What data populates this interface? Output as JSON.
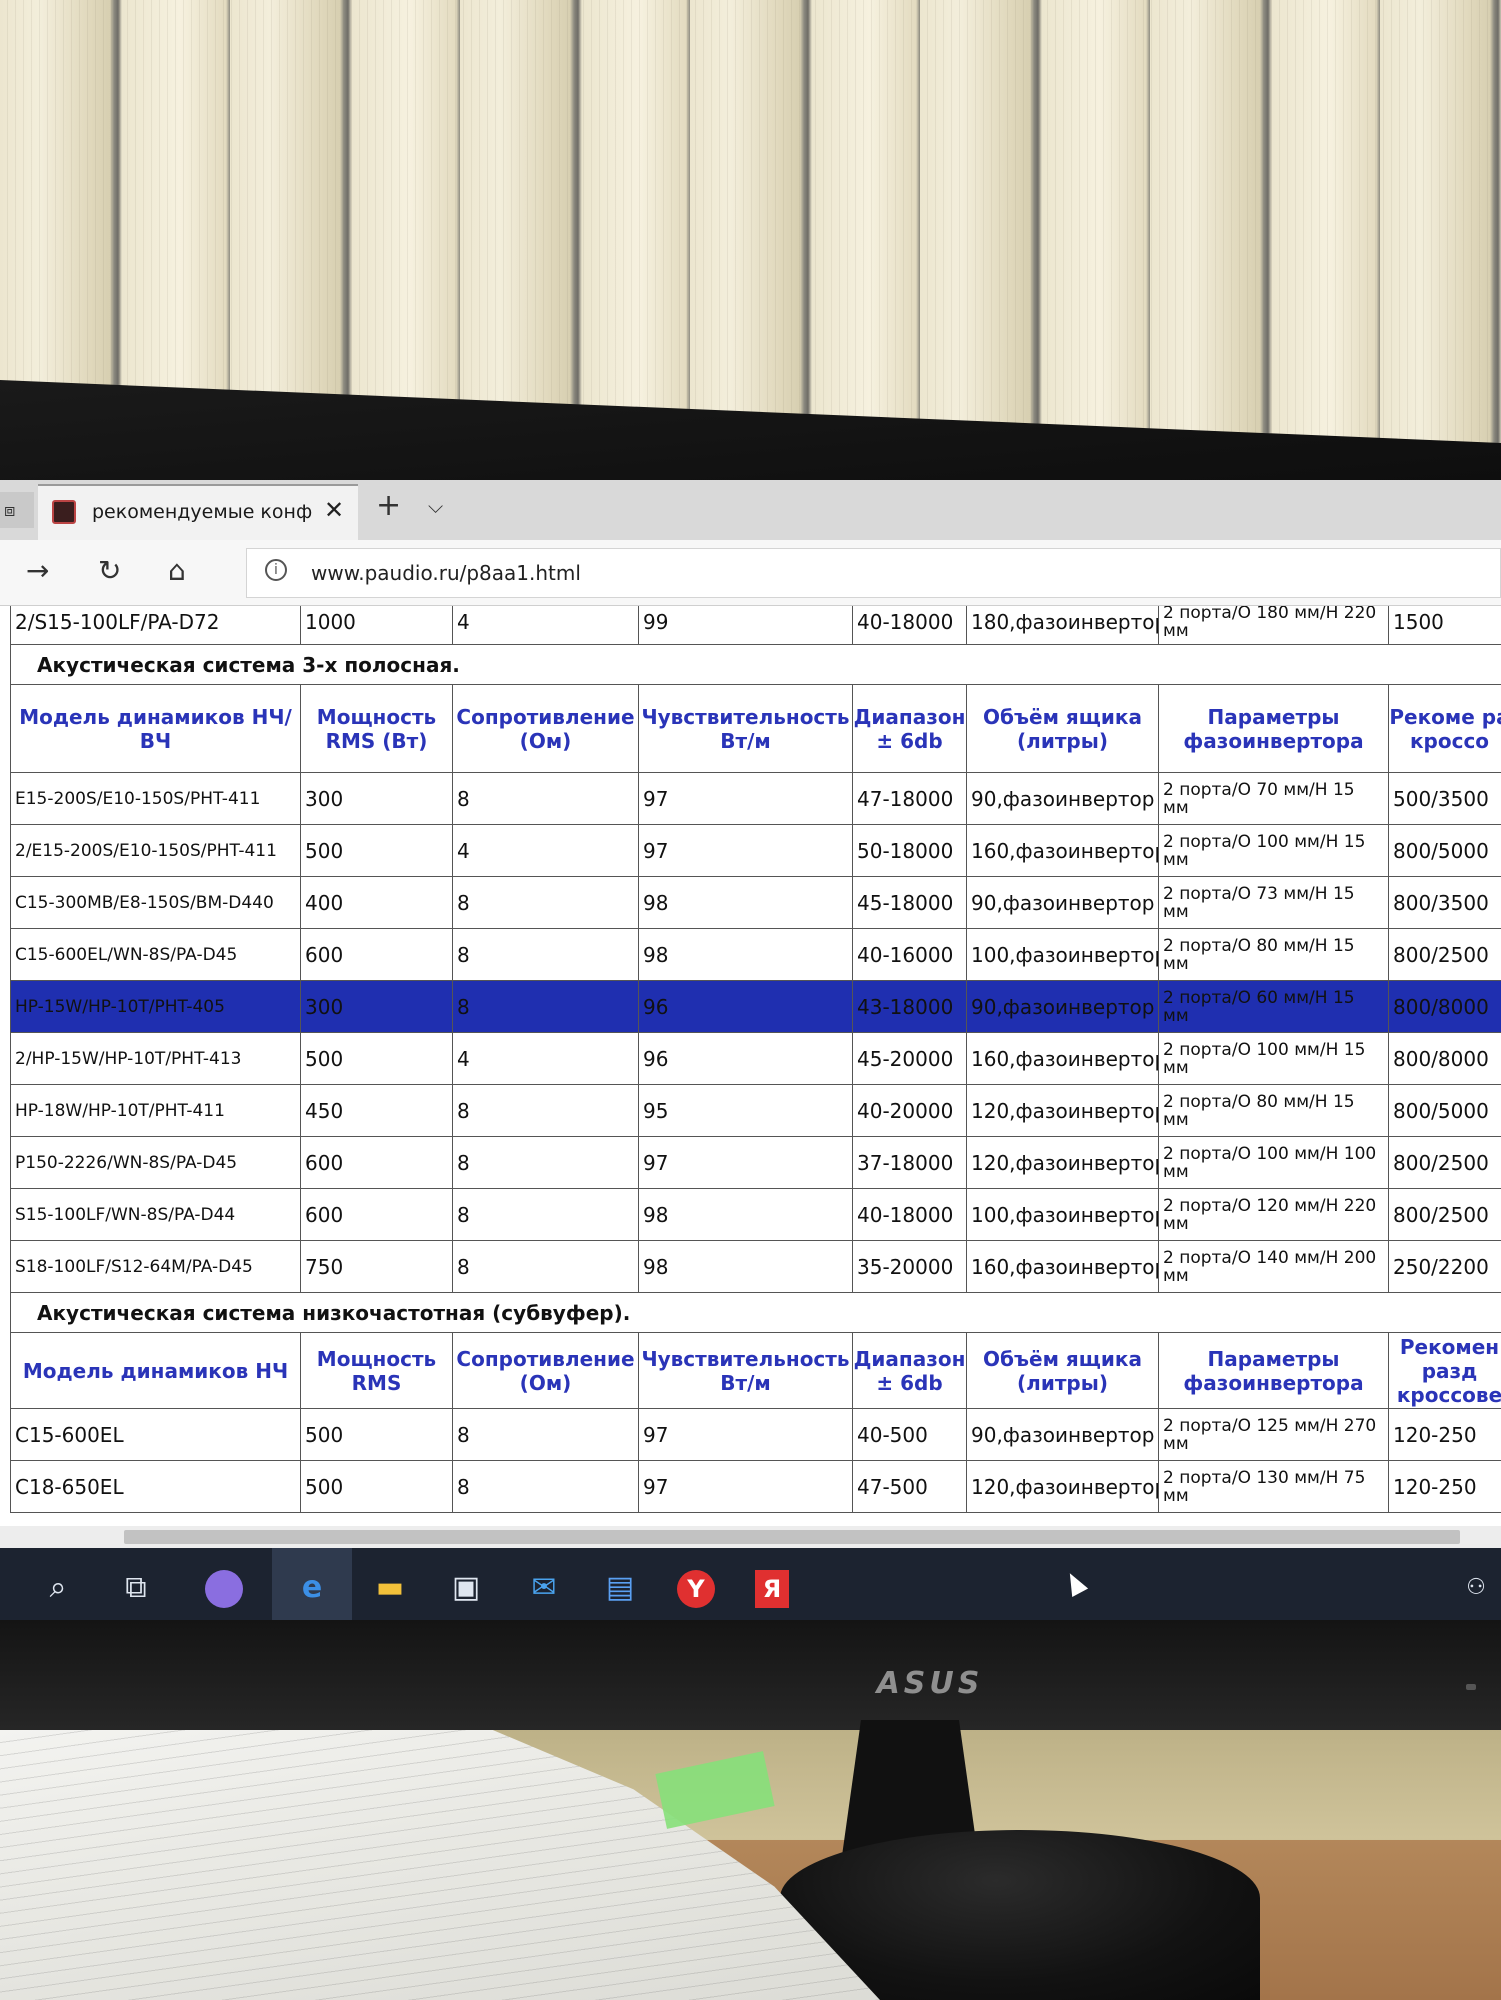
{
  "browser": {
    "tab_title": "рекомендуемые конфи",
    "tab_close": "✕",
    "new_tab": "+",
    "tab_list": "⌵",
    "url": "www.paudio.ru/p8aa1.html"
  },
  "prev_row": [
    "2/S15-100LF/PA-D72",
    "1000",
    "4",
    "99",
    "40-18000",
    "180,фазоинвертор",
    "2 порта/О 180 мм/Н 220 мм",
    "1500"
  ],
  "section3": {
    "title": "Акустическая система 3-х полосная.",
    "headers": [
      "Модель динамиков НЧ/ВЧ",
      "Мощность RMS (Вт)",
      "Сопротивление (Ом)",
      "Чувствительность Вт/м",
      "Диапазон ± 6db",
      "Объём ящика (литры)",
      "Параметры фазоинвертора",
      "Рекоме ра кроссо"
    ],
    "rows": [
      [
        "E15-200S/E10-150S/PHT-411",
        "300",
        "8",
        "97",
        "47-18000",
        "90,фазоинвертор",
        "2 порта/О 70 мм/Н 15 мм",
        "500/3500"
      ],
      [
        "2/E15-200S/E10-150S/PHT-411",
        "500",
        "4",
        "97",
        "50-18000",
        "160,фазоинвертор",
        "2 порта/О 100 мм/Н 15 мм",
        "800/5000"
      ],
      [
        "C15-300MB/E8-150S/BM-D440",
        "400",
        "8",
        "98",
        "45-18000",
        "90,фазоинвертор",
        "2 порта/О 73 мм/Н 15 мм",
        "800/3500"
      ],
      [
        "C15-600EL/WN-8S/PA-D45",
        "600",
        "8",
        "98",
        "40-16000",
        "100,фазоинвертор",
        "2 порта/О 80 мм/Н 15 мм",
        "800/2500"
      ],
      [
        "HP-15W/HP-10T/PHT-405",
        "300",
        "8",
        "96",
        "43-18000",
        "90,фазоинвертор",
        "2 порта/О 60 мм/Н 15 мм",
        "800/8000"
      ],
      [
        "2/HP-15W/HP-10T/PHT-413",
        "500",
        "4",
        "96",
        "45-20000",
        "160,фазоинвертор",
        "2 порта/О 100 мм/Н 15 мм",
        "800/8000"
      ],
      [
        "HP-18W/HP-10T/PHT-411",
        "450",
        "8",
        "95",
        "40-20000",
        "120,фазоинвертор",
        "2 порта/О 80 мм/Н 15 мм",
        "800/5000"
      ],
      [
        "P150-2226/WN-8S/PA-D45",
        "600",
        "8",
        "97",
        "37-18000",
        "120,фазоинвертор",
        "2 порта/О 100 мм/Н 100 мм",
        "800/2500"
      ],
      [
        "S15-100LF/WN-8S/PA-D44",
        "600",
        "8",
        "98",
        "40-18000",
        "100,фазоинвертор",
        "2 порта/О 120 мм/Н 220 мм",
        "800/2500"
      ],
      [
        "S18-100LF/S12-64M/PA-D45",
        "750",
        "8",
        "98",
        "35-20000",
        "160,фазоинвертор",
        "2 порта/О 140 мм/Н 200 мм",
        "250/2200"
      ]
    ]
  },
  "section_sub": {
    "title": "Акустическая система низкочастотная (субвуфер).",
    "headers": [
      "Модель динамиков НЧ",
      "Мощность RMS",
      "Сопротивление (Ом)",
      "Чувствительность Вт/м",
      "Диапазон ± 6db",
      "Объём ящика (литры)",
      "Параметры фазоинвертора",
      "Рекомен разд кроссове"
    ],
    "rows": [
      [
        "C15-600EL",
        "500",
        "8",
        "97",
        "40-500",
        "90,фазоинвертор",
        "2 порта/О 125 мм/Н 270 мм",
        "120-250"
      ],
      [
        "C18-650EL",
        "500",
        "8",
        "97",
        "47-500",
        "120,фазоинвертор",
        "2 порта/О 130 мм/Н 75 мм",
        "120-250"
      ]
    ]
  },
  "monitor": {
    "brand": "ASUS"
  },
  "taskbar": {
    "items": [
      "search-icon",
      "task-view-icon",
      "alice-icon",
      "edge-icon",
      "explorer-icon",
      "store-icon",
      "mail-icon",
      "notepad-icon",
      "yandex-browser-icon",
      "yandex-icon"
    ]
  }
}
